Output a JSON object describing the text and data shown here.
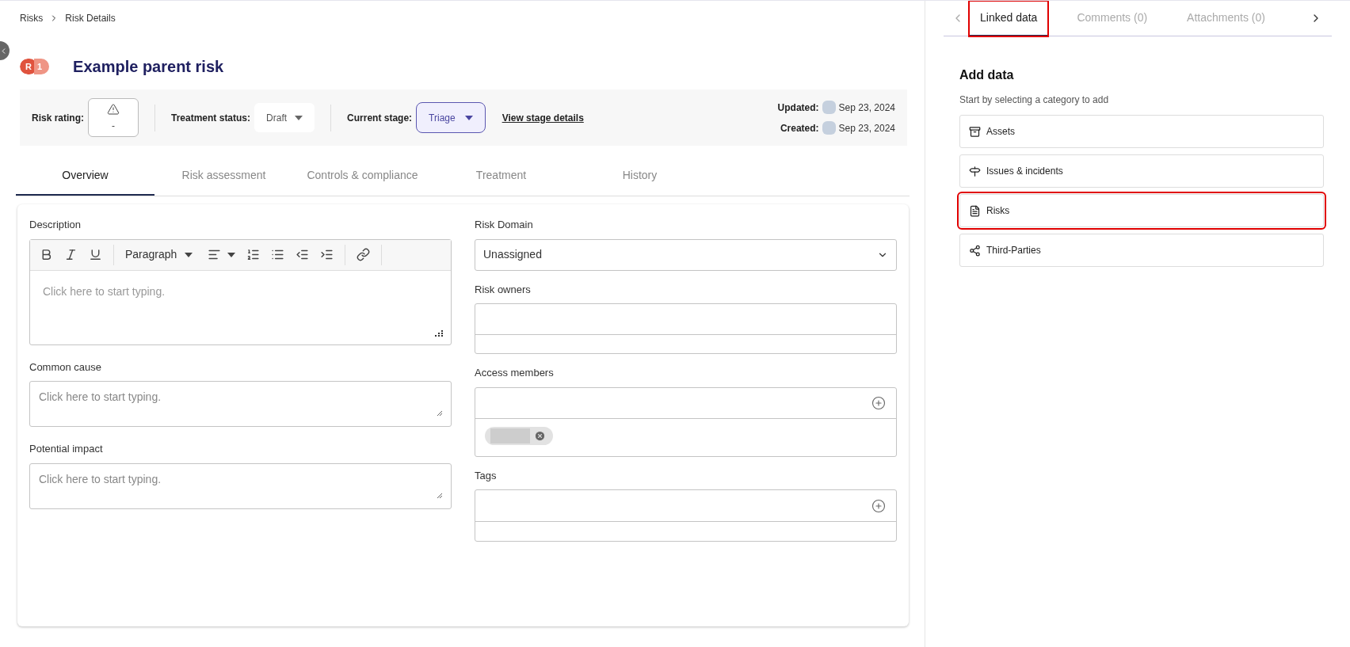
{
  "breadcrumb": [
    {
      "label": "Risks"
    },
    {
      "label": "Risk Details"
    }
  ],
  "header": {
    "badge_letter": "R",
    "badge_count": "1",
    "title": "Example parent risk"
  },
  "meta": {
    "risk_rating_label": "Risk rating:",
    "risk_rating_value": "-",
    "treatment_status_label": "Treatment status:",
    "treatment_status_value": "Draft",
    "current_stage_label": "Current stage:",
    "current_stage_value": "Triage",
    "stage_link": "View stage details",
    "updated_label": "Updated:",
    "updated_date": "Sep 23, 2024",
    "created_label": "Created:",
    "created_date": "Sep 23, 2024"
  },
  "tabs": [
    {
      "label": "Overview",
      "selected": true
    },
    {
      "label": "Risk assessment",
      "selected": false
    },
    {
      "label": "Controls & compliance",
      "selected": false
    },
    {
      "label": "Treatment",
      "selected": false
    },
    {
      "label": "History",
      "selected": false
    }
  ],
  "form": {
    "description": {
      "label": "Description",
      "paragraph_style": "Paragraph",
      "placeholder": "Click here to start typing."
    },
    "common_cause": {
      "label": "Common cause",
      "placeholder": "Click here to start typing."
    },
    "potential_impact": {
      "label": "Potential impact",
      "placeholder": "Click here to start typing."
    },
    "risk_domain": {
      "label": "Risk Domain",
      "value": "Unassigned"
    },
    "risk_owners": {
      "label": "Risk owners"
    },
    "access_members": {
      "label": "Access members",
      "member_chips": [
        {
          "removable": true
        }
      ]
    },
    "tags": {
      "label": "Tags"
    }
  },
  "side_tabs": [
    {
      "label": "Linked data",
      "selected": true,
      "highlighted": true
    },
    {
      "label": "Comments (0)",
      "selected": false,
      "highlighted": false
    },
    {
      "label": "Attachments (0)",
      "selected": false,
      "highlighted": false
    }
  ],
  "add_data": {
    "title": "Add data",
    "subtitle": "Start by selecting a category to add",
    "categories": [
      {
        "kind": "assets",
        "label": "Assets",
        "highlighted": false
      },
      {
        "kind": "issues",
        "label": "Issues & incidents",
        "highlighted": false
      },
      {
        "kind": "risks",
        "label": "Risks",
        "highlighted": true
      },
      {
        "kind": "third_parties",
        "label": "Third-Parties",
        "highlighted": false
      }
    ]
  }
}
